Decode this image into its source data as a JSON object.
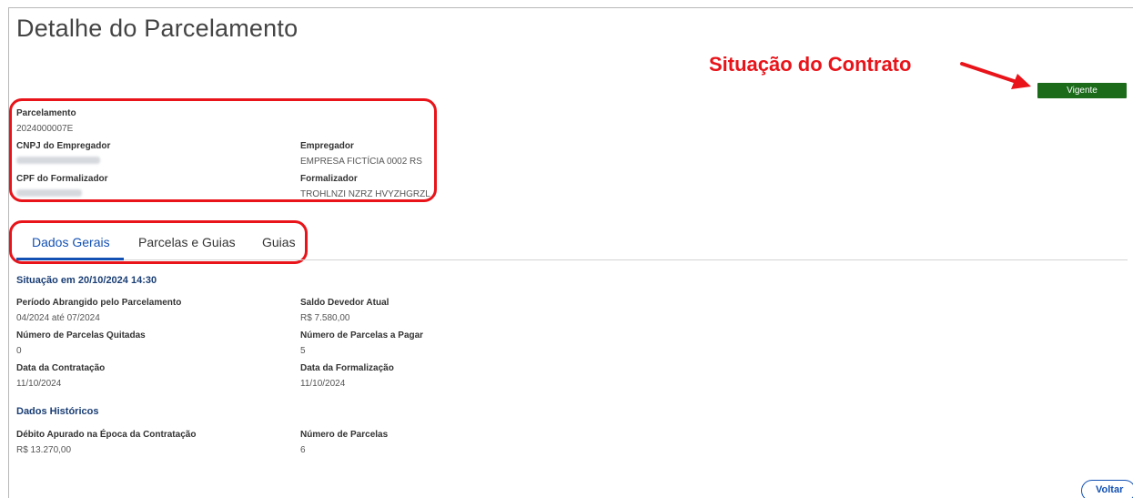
{
  "page": {
    "title": "Detalhe do Parcelamento"
  },
  "annotation": {
    "text": "Situação do Contrato",
    "color": "#e8141a"
  },
  "status": {
    "label": "Vigente",
    "color": "#1b6b1b"
  },
  "header_fields": {
    "parcelamento_label": "Parcelamento",
    "parcelamento_value": "2024000007E",
    "cnpj_label": "CNPJ do Empregador",
    "empregador_label": "Empregador",
    "empregador_value": "EMPRESA FICTÍCIA 0002 RS",
    "cpf_label": "CPF do Formalizador",
    "formalizador_label": "Formalizador",
    "formalizador_value": "TROHLNZI NZRZ HVYZHGRZL"
  },
  "tabs": [
    {
      "label": "Dados Gerais",
      "active": true
    },
    {
      "label": "Parcelas e Guias",
      "active": false
    },
    {
      "label": "Guias",
      "active": false
    }
  ],
  "situacao": {
    "title": "Situação em 20/10/2024 14:30",
    "periodo_label": "Período Abrangido pelo Parcelamento",
    "periodo_value": "04/2024 até 07/2024",
    "saldo_label": "Saldo Devedor Atual",
    "saldo_value": "R$ 7.580,00",
    "quitadas_label": "Número de Parcelas Quitadas",
    "quitadas_value": "0",
    "a_pagar_label": "Número de Parcelas a Pagar",
    "a_pagar_value": "5",
    "contratacao_label": "Data da Contratação",
    "contratacao_value": "11/10/2024",
    "formalizacao_label": "Data da Formalização",
    "formalizacao_value": "11/10/2024"
  },
  "historicos": {
    "title": "Dados Históricos",
    "debito_label": "Débito Apurado na Época da Contratação",
    "debito_value": "R$ 13.270,00",
    "num_parcelas_label": "Número de Parcelas",
    "num_parcelas_value": "6"
  },
  "actions": {
    "back_label": "Voltar"
  }
}
